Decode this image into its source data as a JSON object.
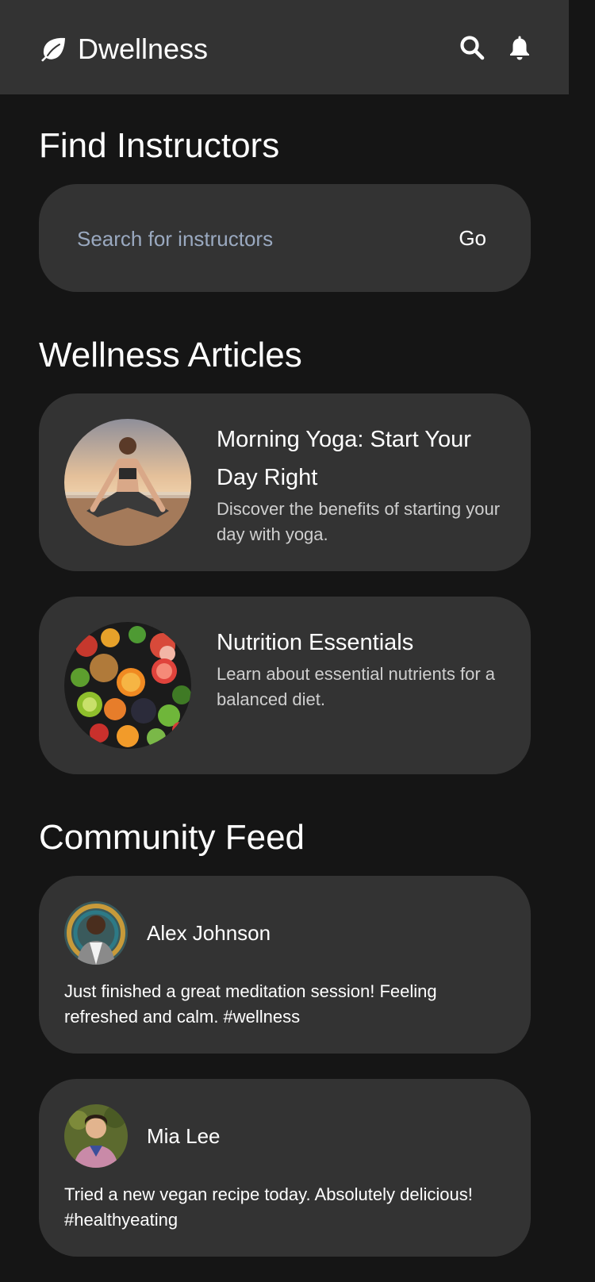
{
  "app": {
    "name": "Dwellness",
    "logo_icon": "leaf-icon",
    "header_icons": [
      "search-icon",
      "bell-icon"
    ]
  },
  "instructors": {
    "title": "Find Instructors",
    "search_placeholder": "Search for instructors",
    "search_value": "",
    "go_label": "Go"
  },
  "articles": {
    "title": "Wellness Articles",
    "items": [
      {
        "title": "Morning Yoga: Start Your Day Right",
        "description": "Discover the benefits of starting your day with yoga.",
        "image": "yoga-photo"
      },
      {
        "title": "Nutrition Essentials",
        "description": "Learn about essential nutrients for a balanced diet.",
        "image": "fruit-vegetable-photo"
      }
    ]
  },
  "feed": {
    "title": "Community Feed",
    "posts": [
      {
        "author": "Alex Johnson",
        "text": "Just finished a great meditation session! Feeling refreshed and calm. #wellness"
      },
      {
        "author": "Mia Lee",
        "text": "Tried a new vegan recipe today. Absolutely delicious! #healthyeating"
      }
    ]
  },
  "colors": {
    "background": "#151515",
    "surface": "#333333",
    "text": "#ffffff",
    "muted_text": "#cfcfcf",
    "placeholder": "#9aa9c0"
  }
}
